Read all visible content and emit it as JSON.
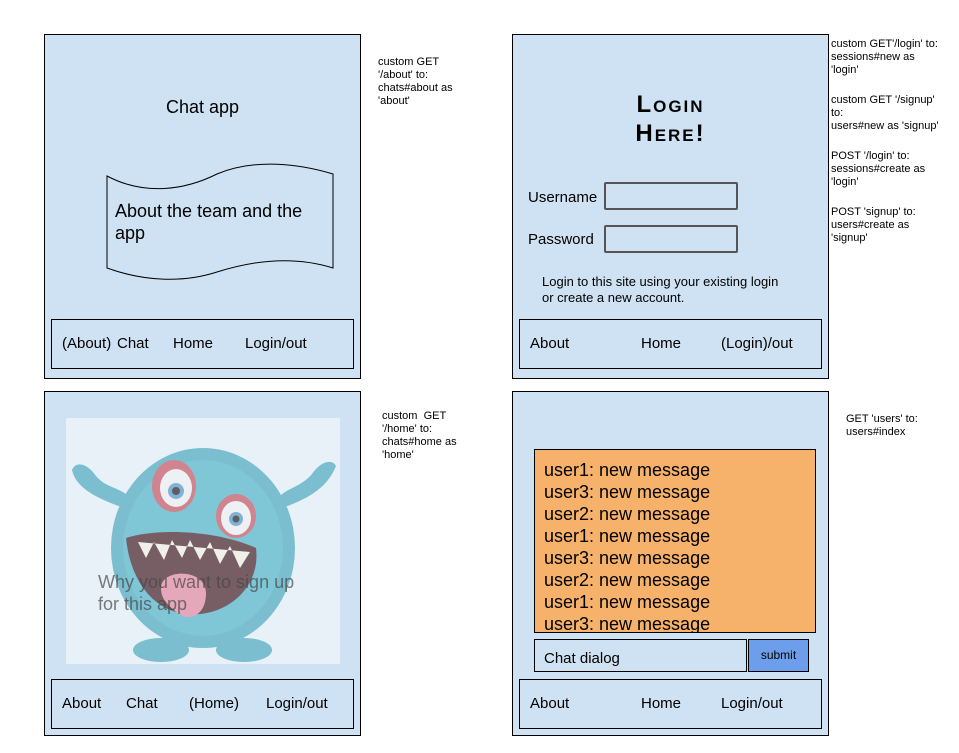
{
  "about_page": {
    "title": "Chat app",
    "banner_text": "About the team and the app",
    "nav": [
      "(About)",
      "Chat",
      "Home",
      "Login/out"
    ],
    "note": "custom GET\n'/about' to:\nchats#about as\n'about'"
  },
  "login_page": {
    "title_line1": "Login",
    "title_line2": "Here!",
    "username_label": "Username",
    "password_label": "Password",
    "info_line1": "Login to this site using your existing login",
    "info_line2": "or create a new account.",
    "nav": [
      "About",
      "Home",
      "(Login)/out"
    ],
    "notes": [
      "custom GET'/login' to:\nsessions#new as\n'login'",
      "custom GET '/signup'\nto:\nusers#new as 'signup'",
      "POST '/login' to:\nsessions#create as\n'login'",
      "POST 'signup' to:\nusers#create as\n'signup'"
    ]
  },
  "home_page": {
    "image_icon": "fuzzy-blue-monster-image",
    "caption_line1": "Why you want to sign up",
    "caption_line2": "for this app",
    "nav": [
      "About",
      "Chat",
      "(Home)",
      "Login/out"
    ],
    "note": "custom  GET\n'/home' to:\nchats#home as\n'home'"
  },
  "chat_page": {
    "messages": [
      "user1: new message",
      "user3: new message",
      "user2: new message",
      "user1: new message",
      "user3: new message",
      "user2: new message",
      "user1: new message",
      "user3: new message"
    ],
    "chat_input_placeholder": "Chat dialog",
    "submit_label": "submit",
    "nav": [
      "About",
      "Home",
      "Login/out"
    ],
    "note": "GET 'users' to:\nusers#index"
  },
  "colors": {
    "panel": "#cfe2f3",
    "message_box": "#f6b26b",
    "submit_button": "#6d9eeb",
    "monster": "#3fa3b8"
  }
}
